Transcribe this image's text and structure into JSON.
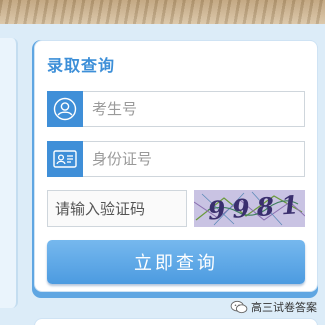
{
  "query_card": {
    "title": "录取查询",
    "exam_number": {
      "placeholder": "考生号",
      "value": ""
    },
    "id_number": {
      "placeholder": "身份证号",
      "value": ""
    },
    "captcha": {
      "placeholder": "请输入验证码",
      "value": "",
      "image_text": "9981"
    },
    "submit_label": "立即查询"
  },
  "icons": {
    "exam_number_field": "user-circle-icon",
    "id_number_field": "id-card-icon",
    "watermark": "wechat-icon"
  },
  "colors": {
    "accent": "#3f8fd8",
    "title": "#3d8fd8",
    "button": "#5aa6e6",
    "page_background": "#dcecf8",
    "captcha_background": "#c9c3e3"
  },
  "watermark": {
    "text": "高三试卷答案"
  }
}
